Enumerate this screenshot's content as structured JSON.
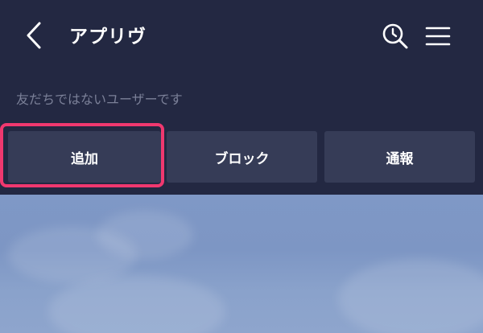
{
  "header": {
    "title": "アプリヴ",
    "back_icon": "chevron-left-icon",
    "search_icon": "search-history-icon",
    "menu_icon": "hamburger-menu-icon"
  },
  "notice": {
    "text": "友だちではないユーザーです"
  },
  "actions": {
    "add_label": "追加",
    "block_label": "ブロック",
    "report_label": "通報"
  },
  "colors": {
    "header_bg": "#232842",
    "button_bg": "#363c57",
    "highlight": "#f0386f",
    "chat_bg": "#7f98c6"
  }
}
